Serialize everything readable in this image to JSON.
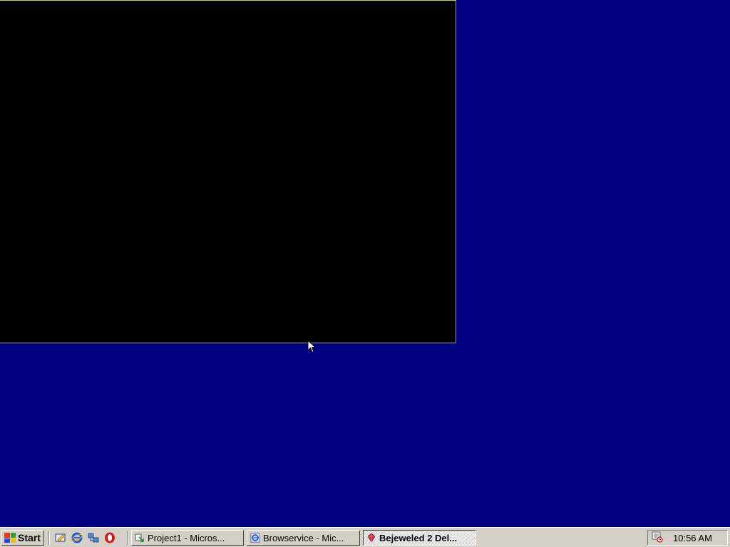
{
  "taskbar": {
    "start_label": "Start",
    "quick_launch": [
      {
        "icon": "show-desktop-icon"
      },
      {
        "icon": "internet-explorer-icon"
      },
      {
        "icon": "network-icon"
      },
      {
        "icon": "opera-icon"
      }
    ],
    "tasks": [
      {
        "label": "Project1 - Micros...",
        "icon": "vb-project-icon",
        "active": false
      },
      {
        "label": "Browservice - Mic...",
        "icon": "internet-explorer-icon",
        "active": false
      },
      {
        "label": "Bejeweled 2 Del...",
        "icon": "bejeweled-gem-icon",
        "active": true
      }
    ],
    "tray": {
      "icons": [
        "scheduler-icon"
      ],
      "clock": "10:56 AM"
    }
  },
  "colors": {
    "desktop": "#000080",
    "taskbar": "#d4d0c8",
    "game_window": "#000000"
  }
}
